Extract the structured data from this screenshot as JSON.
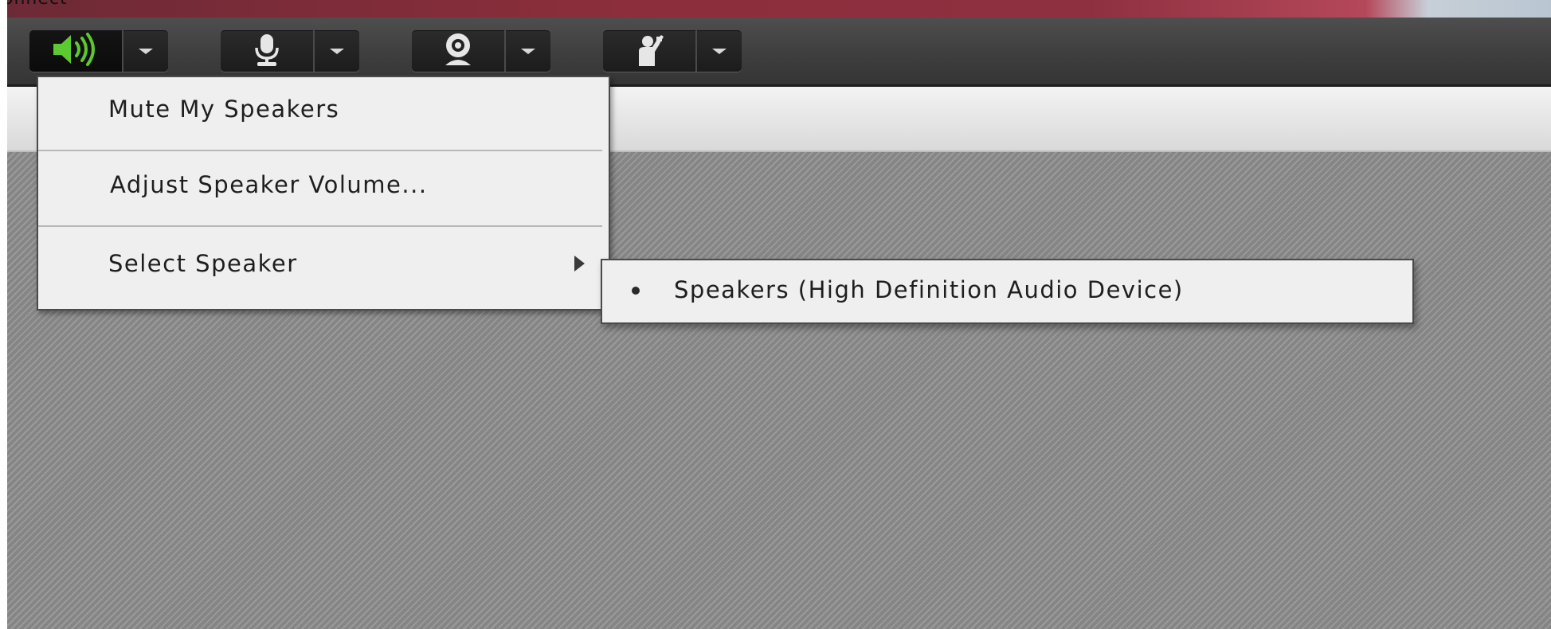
{
  "window": {
    "title": "onnect"
  },
  "toolbar": {
    "buttons": [
      {
        "name": "speaker",
        "icon": "speaker-volume-icon",
        "active": true,
        "color": "#5cc832"
      },
      {
        "name": "microphone",
        "icon": "microphone-icon",
        "active": false,
        "color": "#e6e6e6"
      },
      {
        "name": "camera",
        "icon": "webcam-icon",
        "active": false,
        "color": "#e6e6e6"
      },
      {
        "name": "raise-hand",
        "icon": "raise-hand-icon",
        "active": false,
        "color": "#e6e6e6"
      }
    ],
    "dropdown_icon": "chevron-down-icon"
  },
  "speaker_menu": {
    "items": [
      {
        "label": "Mute My Speakers"
      },
      {
        "label": "Adjust Speaker Volume..."
      },
      {
        "label": "Select Speaker",
        "has_submenu": true
      }
    ],
    "submenu_arrow_icon": "chevron-right-icon"
  },
  "speaker_submenu": {
    "items": [
      {
        "label": "Speakers (High Definition Audio Device)",
        "selected": true
      }
    ],
    "bullet_icon": "radio-bullet-icon"
  }
}
